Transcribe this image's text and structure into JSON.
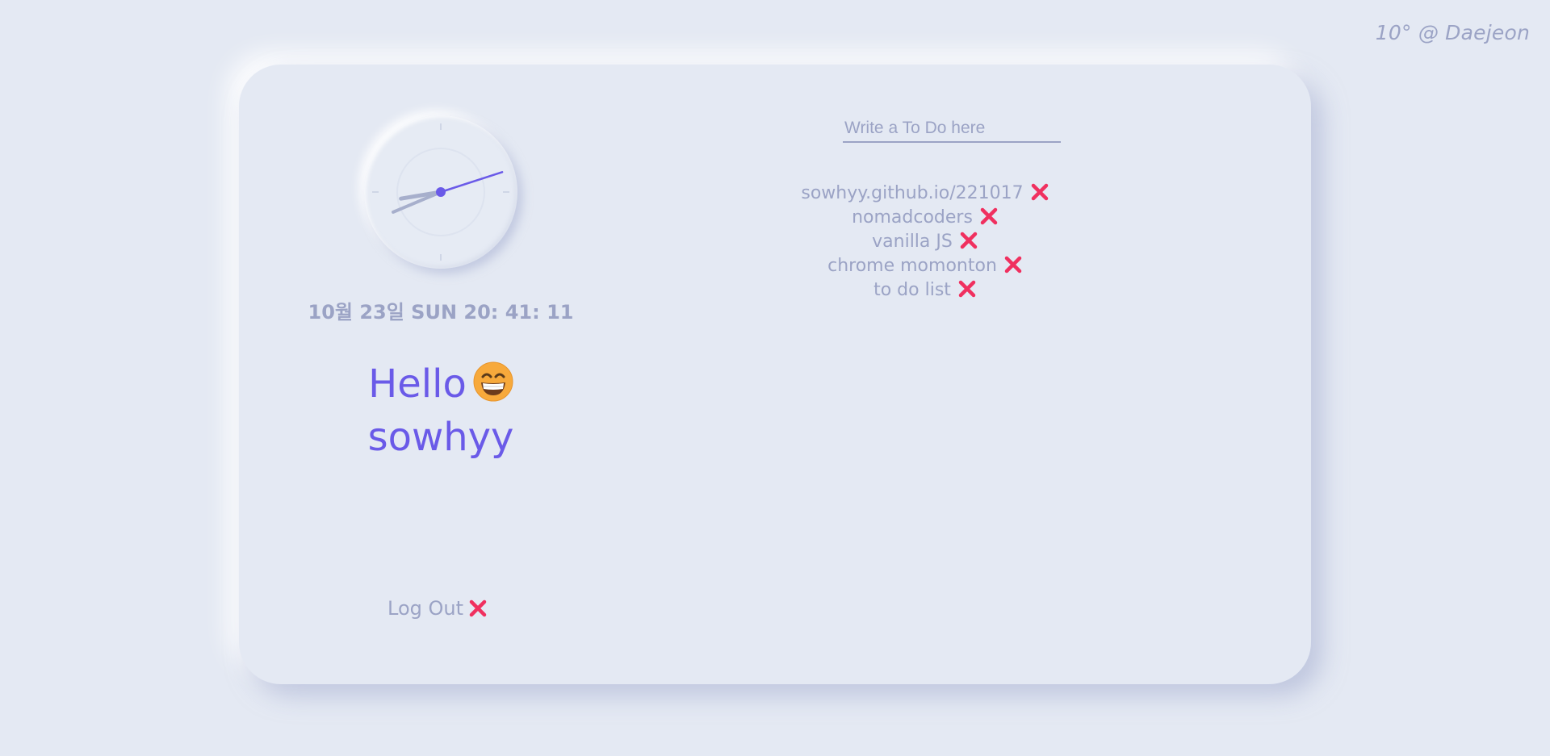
{
  "weather": {
    "text": "10° @ Daejeon"
  },
  "clock": {
    "datetime": "10월 23일 SUN 20: 41: 11",
    "hour": 20,
    "minute": 41,
    "second": 11
  },
  "greeting": {
    "hello": "Hello",
    "emoji": "grinning-face-with-smiling-eyes",
    "name": "sowhyy"
  },
  "logout": {
    "label": "Log Out"
  },
  "todo": {
    "placeholder": "Write a To Do here",
    "items": [
      {
        "text": "sowhyy.github.io/221017"
      },
      {
        "text": "nomadcoders"
      },
      {
        "text": "vanilla JS"
      },
      {
        "text": "chrome momonton"
      },
      {
        "text": "to do list"
      }
    ]
  },
  "colors": {
    "background": "#e4e9f3",
    "text_muted": "#9ba3c5",
    "accent": "#6a5ae8",
    "delete": "#f0305f"
  }
}
